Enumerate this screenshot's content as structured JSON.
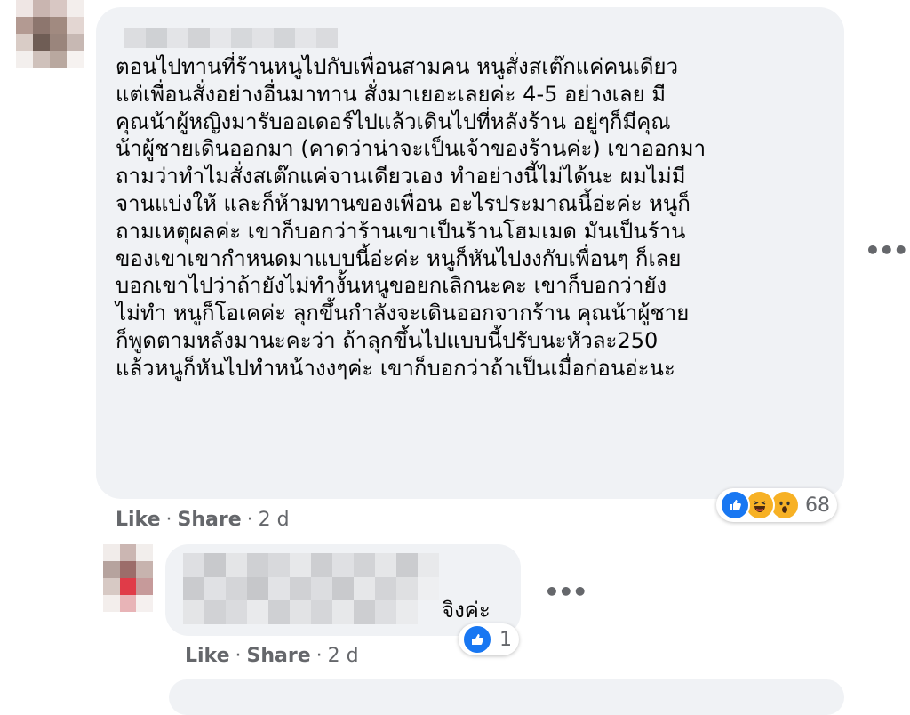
{
  "comment": {
    "text_lines": [
      "ตอนไปทานที่ร้านหนูไปกับเพื่อนสามคน หนูสั่งสเต๊กแค่คนเดียว",
      "แต่เพื่อนสั่งอย่างอื่นมาทาน สั่งมาเยอะเลยค่ะ 4-5 อย่างเลย มี",
      "คุณน้าผู้หญิงมารับออเดอร์ไปแล้วเดินไปที่หลังร้าน อยู่ๆก็มีคุณ",
      "น้าผู้ชายเดินออกมา (คาดว่าน่าจะเป็นเจ้าของร้านค่ะ) เขาออกมา",
      "ถามว่าทำไมสั่งสเต๊กแค่จานเดียวเอง ทำอย่างนี้ไม่ได้นะ ผมไม่มี",
      "จานแบ่งให้ และก็ห้ามทานของเพื่อน อะไรประมาณนี้อ่ะค่ะ หนูก็",
      "ถามเหตุผลค่ะ เขาก็บอกว่าร้านเขาเป็นร้านโฮมเมด มันเป็นร้าน",
      "ของเขาเขากำหนดมาแบบนี้อ่ะค่ะ หนูก็หันไปงงกับเพื่อนๆ ก็เลย",
      "บอกเขาไปว่าถ้ายังไม่ทำงั้นหนูขอยกเลิกนะคะ เขาก็บอกว่ายัง",
      "ไม่ทำ หนูก็โอเคค่ะ ลุกขึ้นกำลังจะเดินออกจากร้าน คุณน้าผู้ชาย",
      "ก็พูดตามหลังมานะคะว่า ถ้าลุกขึ้นไปแบบนี้ปรับนะหัวละ250",
      "แล้วหนูก็หันไปทำหน้างงๆค่ะ เขาก็บอกว่าถ้าเป็นเมื่อก่อนอ่ะนะ"
    ],
    "like_label": "Like",
    "share_label": "Share",
    "separator": "·",
    "time": "2 d",
    "reaction_count": "68",
    "reactions": [
      "like-icon",
      "haha-icon",
      "wow-icon"
    ]
  },
  "reply": {
    "text_visible": "จิงค่ะ",
    "like_label": "Like",
    "share_label": "Share",
    "separator": "·",
    "time": "2 d",
    "reaction_count": "1",
    "reactions": [
      "like-icon"
    ]
  },
  "colors": {
    "bubble": "#f0f2f5",
    "meta_text": "#65676b",
    "like_blue": "#1877f2",
    "reaction_yellow": "#f7b125"
  }
}
